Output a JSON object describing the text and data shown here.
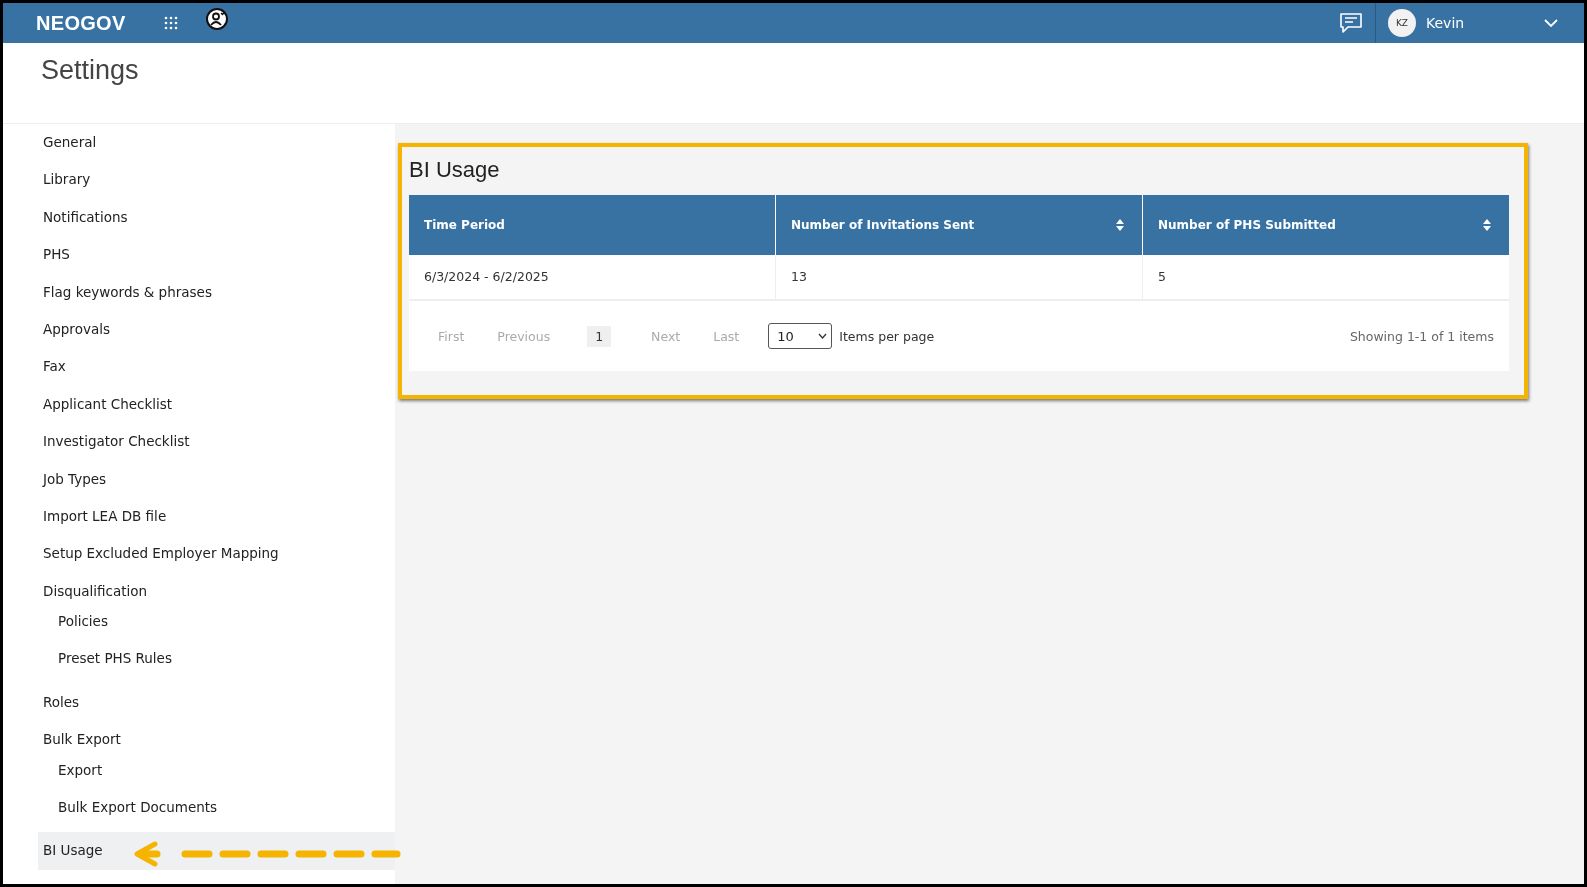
{
  "top_bar": {
    "logo": "NEOGOV",
    "user": {
      "initials": "KZ",
      "name": "Kevin"
    }
  },
  "page_title": "Settings",
  "sidebar": {
    "items": [
      {
        "label": "General",
        "selected": false
      },
      {
        "label": "Library",
        "selected": false
      },
      {
        "label": "Notifications",
        "selected": false
      },
      {
        "label": "PHS",
        "selected": false
      },
      {
        "label": "Flag keywords & phrases",
        "selected": false
      },
      {
        "label": "Approvals",
        "selected": false
      },
      {
        "label": "Fax",
        "selected": false
      },
      {
        "label": "Applicant Checklist",
        "selected": false
      },
      {
        "label": "Investigator Checklist",
        "selected": false
      },
      {
        "label": "Job Types",
        "selected": false
      },
      {
        "label": "Import LEA DB file",
        "selected": false
      },
      {
        "label": "Setup Excluded Employer Mapping",
        "selected": false
      },
      {
        "label": "Disqualification",
        "selected": false,
        "children": [
          {
            "label": "Policies",
            "selected": false
          },
          {
            "label": "Preset PHS Rules",
            "selected": false
          }
        ]
      },
      {
        "label": "Roles",
        "selected": false
      },
      {
        "label": "Bulk Export",
        "selected": false,
        "children": [
          {
            "label": "Export",
            "selected": false
          },
          {
            "label": "Bulk Export Documents",
            "selected": false
          }
        ]
      },
      {
        "label": "BI Usage",
        "selected": true
      }
    ]
  },
  "panel": {
    "title": "BI Usage",
    "table": {
      "columns": [
        {
          "label": "Time Period",
          "sortable": false
        },
        {
          "label": "Number of Invitations Sent",
          "sortable": true
        },
        {
          "label": "Number of PHS Submitted",
          "sortable": true
        }
      ],
      "rows": [
        [
          "6/3/2024 - 6/2/2025",
          "13",
          "5"
        ]
      ]
    },
    "pagination": {
      "first": {
        "label": "First",
        "disabled": true
      },
      "previous": {
        "label": "Previous",
        "disabled": true
      },
      "pages": [
        {
          "label": "1",
          "selected": true
        }
      ],
      "next": {
        "label": "Next",
        "disabled": true
      },
      "last": {
        "label": "Last",
        "disabled": true
      },
      "page_size": "10",
      "page_size_label": "Items per page",
      "summary": "Showing 1-1 of 1 items"
    }
  }
}
